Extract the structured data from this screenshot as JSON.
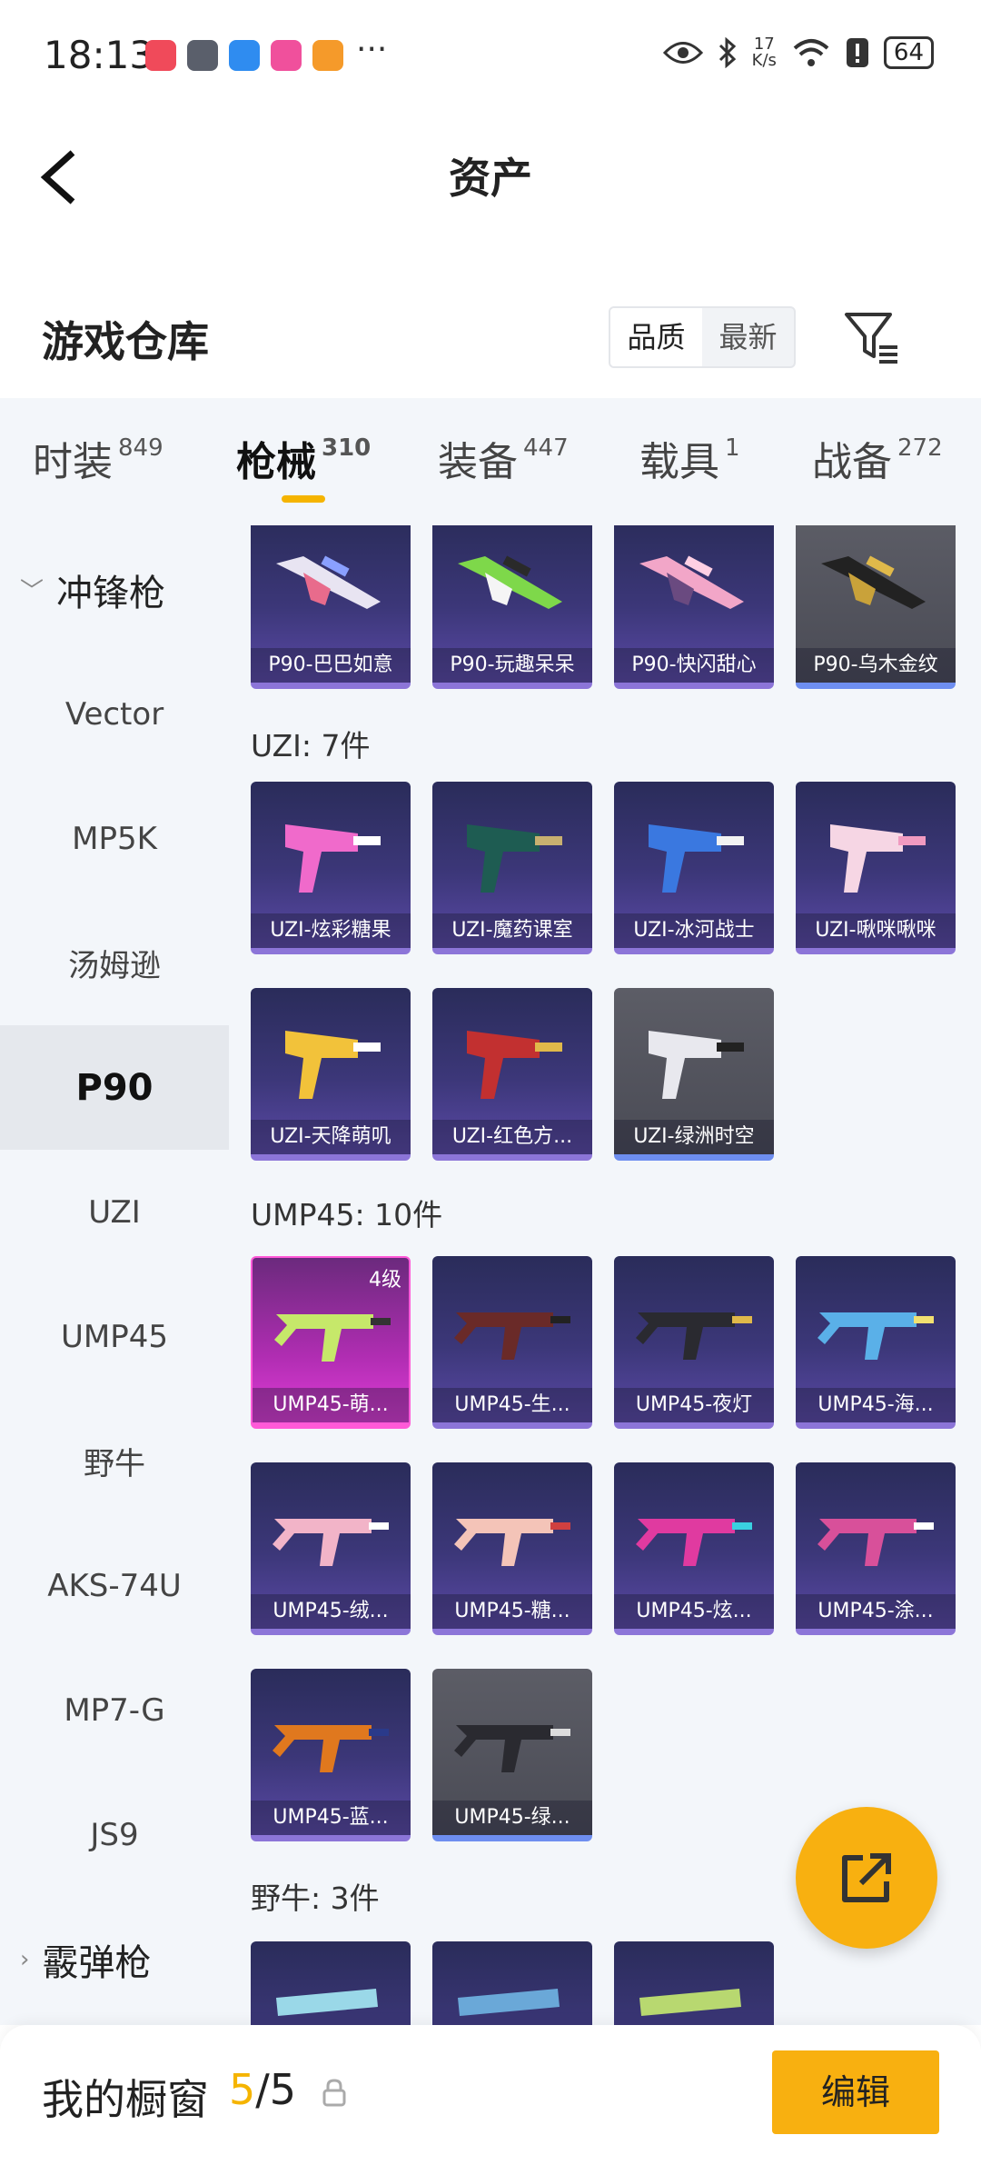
{
  "status_bar": {
    "time": "18:13",
    "net_speed_top": "17",
    "net_speed_unit": "K/s",
    "battery": "64"
  },
  "header": {
    "title": "资产"
  },
  "warehouse": {
    "title": "游戏仓库",
    "sort_options": [
      "品质",
      "最新"
    ],
    "active_sort": "品质"
  },
  "tabs": [
    {
      "label": "时装",
      "count": "849"
    },
    {
      "label": "枪械",
      "count": "310"
    },
    {
      "label": "装备",
      "count": "447"
    },
    {
      "label": "载具",
      "count": "1"
    },
    {
      "label": "战备",
      "count": "272"
    }
  ],
  "active_tab": "枪械",
  "accent_color": "#f5b400",
  "sidebar": {
    "group_open": "冲锋枪",
    "items": [
      "Vector",
      "MP5K",
      "汤姆逊",
      "P90",
      "UZI",
      "UMP45",
      "野牛",
      "AKS-74U",
      "MP7-G",
      "JS9"
    ],
    "active_item": "P90",
    "group_next": "霰弹枪"
  },
  "sections": {
    "p90_cards": [
      {
        "name": "P90-巴巴如意",
        "rarity": "purple"
      },
      {
        "name": "P90-玩趣呆呆",
        "rarity": "purple"
      },
      {
        "name": "P90-快闪甜心",
        "rarity": "purple"
      },
      {
        "name": "P90-乌木金纹",
        "rarity": "gray"
      }
    ],
    "uzi_label": "UZI: 7件",
    "uzi_cards": [
      {
        "name": "UZI-炫彩糖果",
        "rarity": "purple"
      },
      {
        "name": "UZI-魔药课室",
        "rarity": "purple"
      },
      {
        "name": "UZI-冰河战士",
        "rarity": "purple"
      },
      {
        "name": "UZI-啾咪啾咪",
        "rarity": "purple"
      },
      {
        "name": "UZI-天降萌叽",
        "rarity": "purple"
      },
      {
        "name": "UZI-红色方...",
        "rarity": "purple"
      },
      {
        "name": "UZI-绿洲时空",
        "rarity": "gray"
      }
    ],
    "ump_label": "UMP45: 10件",
    "ump_cards": [
      {
        "name": "UMP45-萌...",
        "rarity": "pink",
        "level": "4级"
      },
      {
        "name": "UMP45-生...",
        "rarity": "purple"
      },
      {
        "name": "UMP45-夜灯",
        "rarity": "purple"
      },
      {
        "name": "UMP45-海...",
        "rarity": "purple"
      },
      {
        "name": "UMP45-绒...",
        "rarity": "purple"
      },
      {
        "name": "UMP45-糖...",
        "rarity": "purple"
      },
      {
        "name": "UMP45-炫...",
        "rarity": "purple"
      },
      {
        "name": "UMP45-涂...",
        "rarity": "purple"
      },
      {
        "name": "UMP45-蓝...",
        "rarity": "purple"
      },
      {
        "name": "UMP45-绿...",
        "rarity": "gray"
      }
    ],
    "bison_label": "野牛: 3件"
  },
  "bottom_bar": {
    "title": "我的橱窗",
    "current": "5",
    "total": "/5",
    "edit_label": "编辑"
  }
}
